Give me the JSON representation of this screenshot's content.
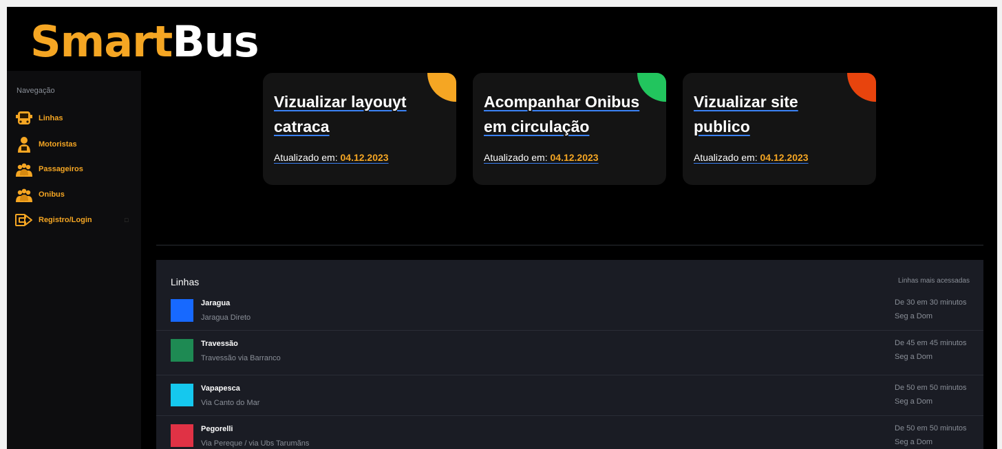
{
  "brand": {
    "part1": "Smart",
    "part2": "Bus",
    "accent": "#f5a623"
  },
  "sidebar": {
    "title": "Navegação",
    "items": [
      {
        "label": "Linhas",
        "icon": "bus-icon"
      },
      {
        "label": "Motoristas",
        "icon": "driver-icon"
      },
      {
        "label": "Passageiros",
        "icon": "passengers-icon"
      },
      {
        "label": "Onibus",
        "icon": "bus-group-icon"
      },
      {
        "label": "Registro/Login",
        "icon": "login-arrow-icon"
      }
    ]
  },
  "cards": [
    {
      "title": "Vizualizar layouyt catraca",
      "updated_label": "Atualizado em:",
      "date": "04.12.2023",
      "corner_color": "#f5a623"
    },
    {
      "title": "Acompanhar Onibus em circulação",
      "updated_label": "Atualizado em:",
      "date": "04.12.2023",
      "corner_color": "#22c55e"
    },
    {
      "title": "Vizualizar site publico",
      "updated_label": "Atualizado em:",
      "date": "04.12.2023",
      "corner_color": "#e8440d"
    }
  ],
  "linhas": {
    "title": "Linhas",
    "subtitle": "Linhas mais acessadas",
    "rows": [
      {
        "name": "Jaragua",
        "route": "Jaragua Direto",
        "frequency": "De 30 em 30 minutos",
        "days": "Seg a Dom",
        "color": "#1769ff"
      },
      {
        "name": "Travessão",
        "route": "Travessão via Barranco",
        "frequency": "De 45 em 45 minutos",
        "days": "Seg a Dom",
        "color": "#1e8a53"
      },
      {
        "name": "Vapapesca",
        "route": "Via Canto do Mar",
        "frequency": "De 50 em 50 minutos",
        "days": "Seg a Dom",
        "color": "#15c8ee"
      },
      {
        "name": "Pegorelli",
        "route": "Via Pereque / via Ubs Tarumãns",
        "frequency": "De 50 em 50 minutos",
        "days": "Seg a Dom",
        "color": "#e03245"
      }
    ]
  }
}
